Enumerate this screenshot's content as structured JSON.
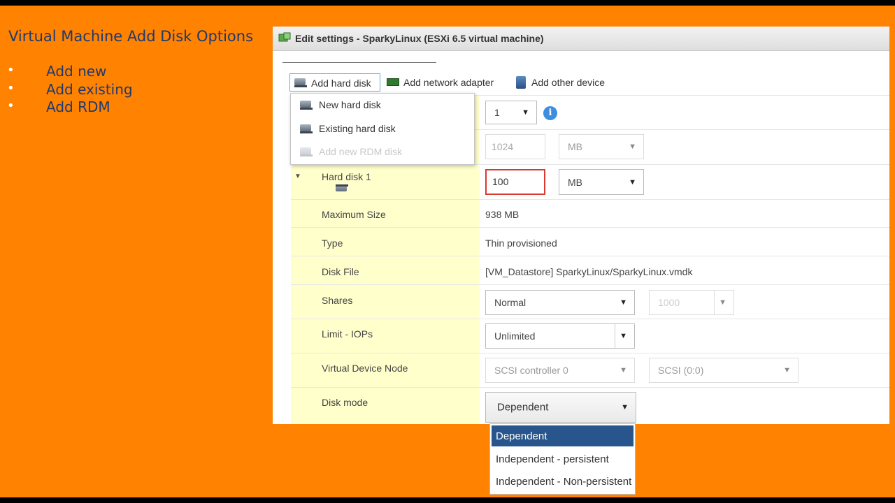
{
  "slide": {
    "title": "Virtual Machine Add Disk Options",
    "bullets": [
      "Add new",
      "Add existing",
      "Add RDM"
    ],
    "bullet_char": "•"
  },
  "dialog": {
    "title": "Edit settings - SparkyLinux (ESXi 6.5 virtual machine)",
    "toolbar": {
      "add_hard_disk": "Add hard disk",
      "add_network_adapter": "Add network adapter",
      "add_other_device": "Add other device"
    },
    "add_disk_menu": {
      "items": [
        {
          "label": "New hard disk",
          "enabled": true
        },
        {
          "label": "Existing hard disk",
          "enabled": true
        },
        {
          "label": "Add new RDM disk",
          "enabled": false
        }
      ]
    },
    "cpu_row": {
      "value": "1",
      "info_icon": "i"
    },
    "memory_row": {
      "value": "1024",
      "unit": "MB"
    },
    "hard_disk": {
      "label": "Hard disk 1",
      "size_value": "100",
      "size_unit": "MB",
      "maximum_size_label": "Maximum Size",
      "maximum_size": "938 MB",
      "type_label": "Type",
      "type": "Thin provisioned",
      "disk_file_label": "Disk File",
      "disk_file": "[VM_Datastore] SparkyLinux/SparkyLinux.vmdk",
      "shares_label": "Shares",
      "shares": "Normal",
      "shares_value": "1000",
      "limit_iops_label": "Limit - IOPs",
      "limit_iops": "Unlimited",
      "virtual_device_node_label": "Virtual Device Node",
      "controller": "SCSI controller 0",
      "scsi_id": "SCSI (0:0)",
      "disk_mode_label": "Disk mode",
      "disk_mode": "Dependent"
    },
    "disk_mode_options": [
      "Dependent",
      "Independent - persistent",
      "Independent - Non-persistent"
    ],
    "disk_mode_selected_index": 0
  },
  "colors": {
    "background": "#ff8200",
    "slide_text": "#1e3a6e",
    "label_column": "#ffffcc",
    "selected_option": "#27558c",
    "error_border": "#d93a2f",
    "info_icon": "#3d8ede"
  }
}
